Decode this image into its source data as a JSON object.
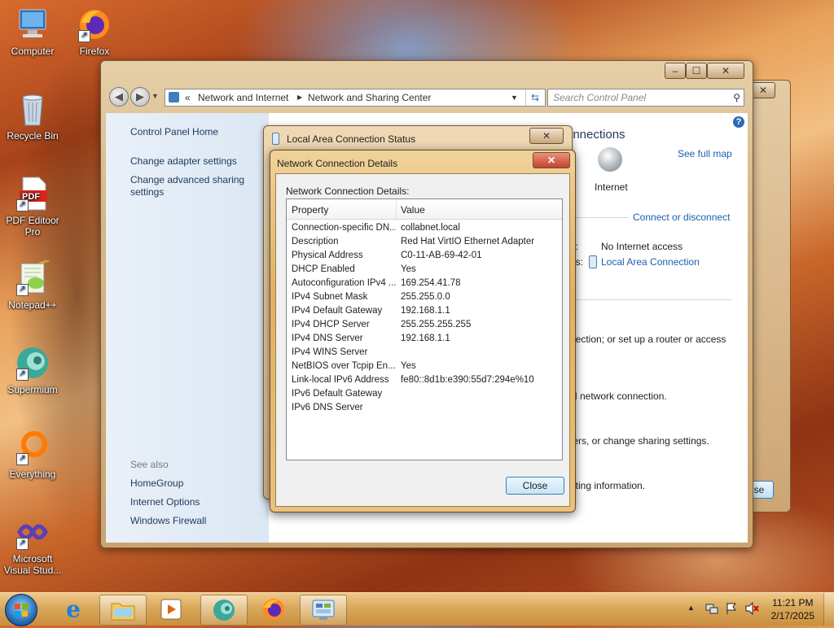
{
  "desktop": {
    "icons": [
      {
        "label": "Computer"
      },
      {
        "label": "Firefox"
      },
      {
        "label": "Recycle Bin"
      },
      {
        "label": "PDF Editoor Pro"
      },
      {
        "label": "Notepad++"
      },
      {
        "label": "Supermium"
      },
      {
        "label": "Everything"
      },
      {
        "label": "Microsoft Visual Stud..."
      }
    ]
  },
  "control_panel": {
    "breadcrumb": {
      "prefix": "«",
      "items": [
        "Network and Internet",
        "Network and Sharing Center"
      ]
    },
    "search_placeholder": "Search Control Panel",
    "left_links": [
      "Control Panel Home",
      "Change adapter settings",
      "Change advanced sharing settings"
    ],
    "see_also": {
      "heading": "See also",
      "items": [
        "HomeGroup",
        "Internet Options",
        "Windows Firewall"
      ]
    },
    "main": {
      "header_partial": "onnections",
      "see_full_map": "See full map",
      "internet_label": "Internet",
      "connect_link": "Connect or disconnect",
      "access_type_suffix": "e:",
      "access_type_value": "No Internet access",
      "connections_suffix": "ns:",
      "connection_link": "Local Area Connection",
      "text1": "nection; or set up a router or access",
      "text2": "N network connection.",
      "text3": "ters, or change sharing settings.",
      "text4": "oting information."
    }
  },
  "background_window": {
    "button_partial": "se"
  },
  "status_dialog": {
    "title": "Local Area Connection Status"
  },
  "details_dialog": {
    "title": "Network Connection Details",
    "label": "Network Connection Details:",
    "columns": [
      "Property",
      "Value"
    ],
    "rows": [
      {
        "property": "Connection-specific DN...",
        "value": "collabnet.local"
      },
      {
        "property": "Description",
        "value": "Red Hat VirtIO Ethernet Adapter"
      },
      {
        "property": "Physical Address",
        "value": "C0-11-AB-69-42-01"
      },
      {
        "property": "DHCP Enabled",
        "value": "Yes"
      },
      {
        "property": "Autoconfiguration IPv4 ...",
        "value": "169.254.41.78"
      },
      {
        "property": "IPv4 Subnet Mask",
        "value": "255.255.0.0"
      },
      {
        "property": "IPv4 Default Gateway",
        "value": "192.168.1.1"
      },
      {
        "property": "IPv4 DHCP Server",
        "value": "255.255.255.255"
      },
      {
        "property": "IPv4 DNS Server",
        "value": "192.168.1.1"
      },
      {
        "property": "IPv4 WINS Server",
        "value": ""
      },
      {
        "property": "NetBIOS over Tcpip En...",
        "value": "Yes"
      },
      {
        "property": "Link-local IPv6 Address",
        "value": "fe80::8d1b:e390:55d7:294e%10"
      },
      {
        "property": "IPv6 Default Gateway",
        "value": ""
      },
      {
        "property": "IPv6 DNS Server",
        "value": ""
      }
    ],
    "close_label": "Close"
  },
  "taskbar": {
    "clock_time": "11:21 PM",
    "clock_date": "2/17/2025"
  }
}
